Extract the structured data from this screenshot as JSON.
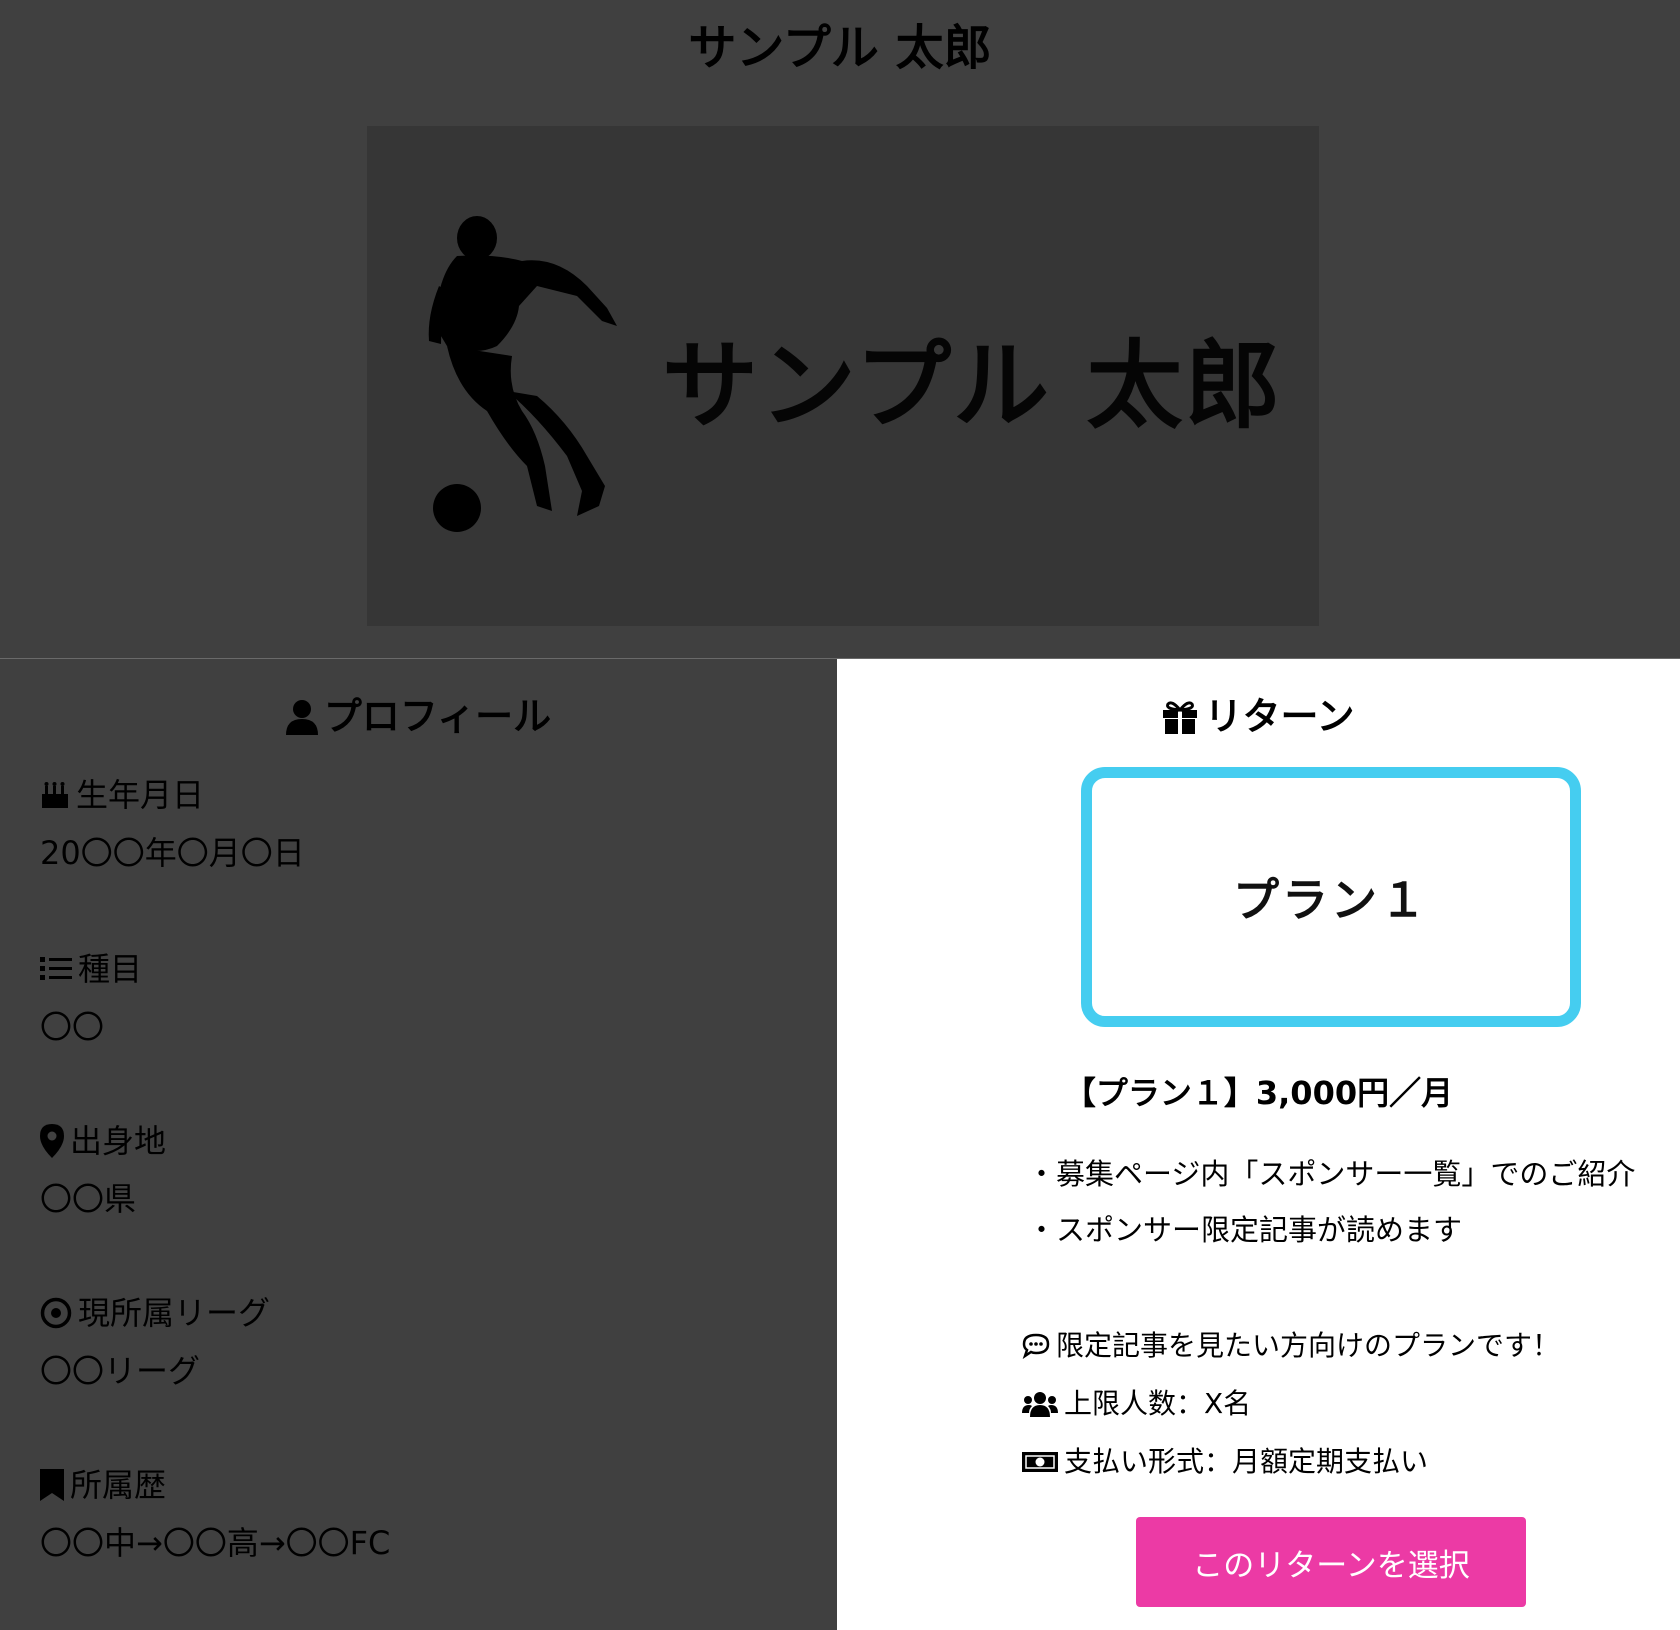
{
  "page": {
    "title": "サンプル 太郎"
  },
  "hero": {
    "name": "サンプル 太郎"
  },
  "profile": {
    "heading": "プロフィール",
    "items": [
      {
        "label": "生年月日",
        "value": "20〇〇年〇月〇日"
      },
      {
        "label": "種目",
        "value": "〇〇"
      },
      {
        "label": "出身地",
        "value": "〇〇県"
      },
      {
        "label": "現所属リーグ",
        "value": "〇〇リーグ"
      },
      {
        "label": "所属歴",
        "value": "〇〇中→〇〇高→〇〇FC"
      }
    ]
  },
  "returns": {
    "heading": "リターン",
    "card_label": "プラン１",
    "price": "【プラン１】3,000円／月",
    "bullets": [
      "・募集ページ内「スポンサー一覧」でのご紹介",
      "・スポンサー限定記事が読めます"
    ],
    "comment": "限定記事を見たい方向けのプランです！",
    "limit": "上限人数：X名",
    "payment": "支払い形式：月額定期支払い",
    "select_label": "このリターンを選択"
  },
  "colors": {
    "accent": "#ec3aa5",
    "card_border": "#45cdf0",
    "panel_dark": "#404040"
  }
}
